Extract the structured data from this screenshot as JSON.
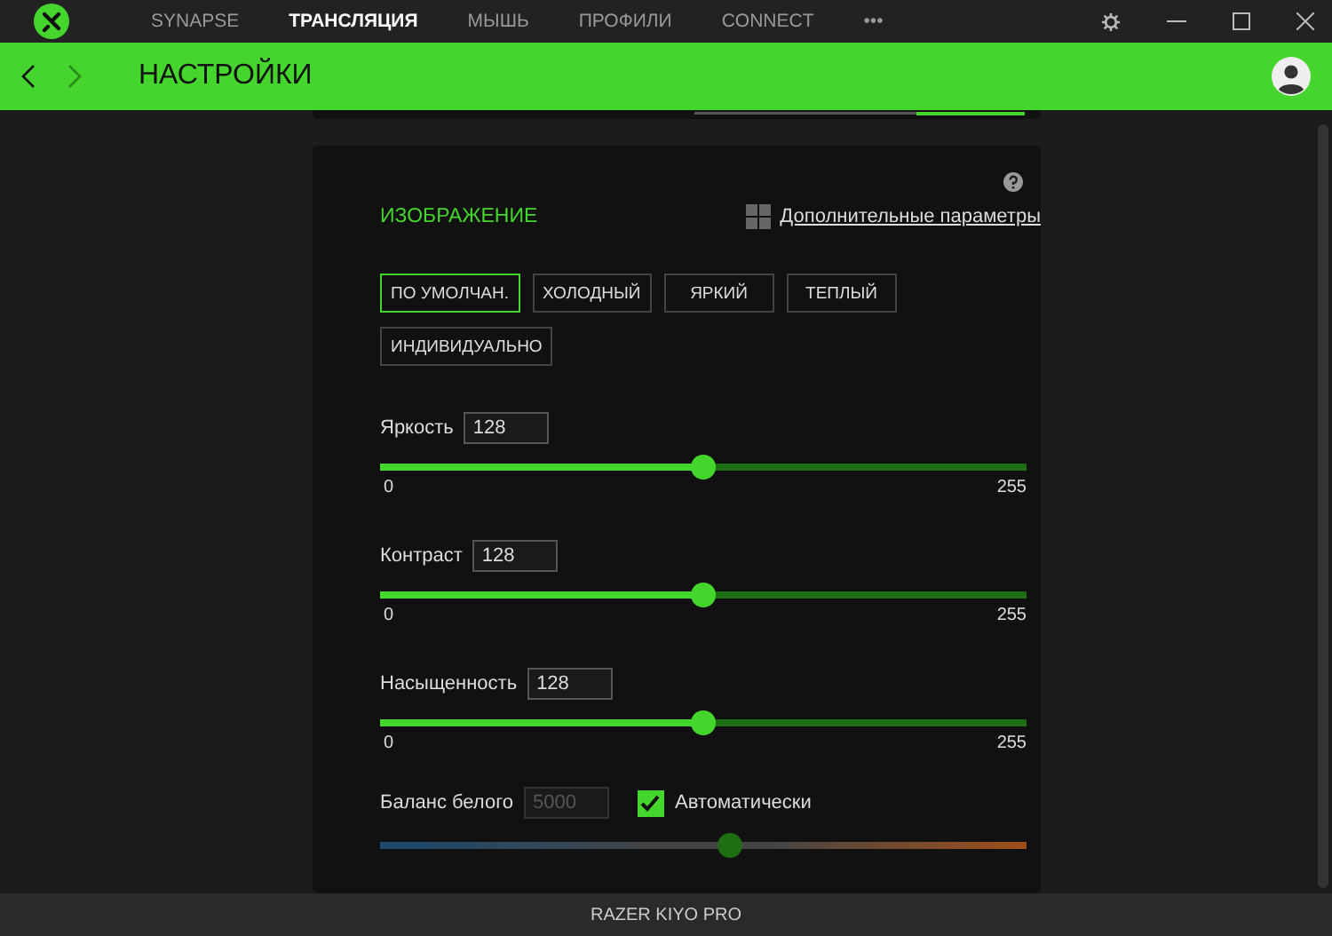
{
  "nav": {
    "tabs": [
      {
        "label": "SYNAPSE",
        "selected": false
      },
      {
        "label": "ТРАНСЛЯЦИЯ",
        "selected": true
      },
      {
        "label": "МЫШЬ",
        "selected": false
      },
      {
        "label": "ПРОФИЛИ",
        "selected": false
      },
      {
        "label": "CONNECT",
        "selected": false
      },
      {
        "label": "•••",
        "selected": false
      }
    ]
  },
  "header": {
    "title": "НАСТРОЙКИ"
  },
  "image_section": {
    "title": "ИЗОБРАЖЕНИЕ",
    "advanced_link": "Дополнительные параметры",
    "presets": [
      {
        "label": "ПО УМОЛЧАН.",
        "selected": true
      },
      {
        "label": "ХОЛОДНЫЙ",
        "selected": false
      },
      {
        "label": "ЯРКИЙ",
        "selected": false
      },
      {
        "label": "ТЕПЛЫЙ",
        "selected": false
      },
      {
        "label": "ИНДИВИДУАЛЬНО",
        "selected": false
      }
    ],
    "sliders": [
      {
        "label": "Яркость",
        "value": "128",
        "level": 0.5,
        "min": "0",
        "max": "255"
      },
      {
        "label": "Контраст",
        "value": "128",
        "level": 0.5,
        "min": "0",
        "max": "255"
      },
      {
        "label": "Насыщенность",
        "value": "128",
        "level": 0.5,
        "min": "0",
        "max": "255"
      }
    ],
    "white_balance": {
      "label": "Баланс белого",
      "value": "5000",
      "disabled": true,
      "auto_label": "Автоматически",
      "checked": true,
      "level": 0.54
    }
  },
  "status_bar": {
    "device": "RAZER KIYO PRO"
  }
}
